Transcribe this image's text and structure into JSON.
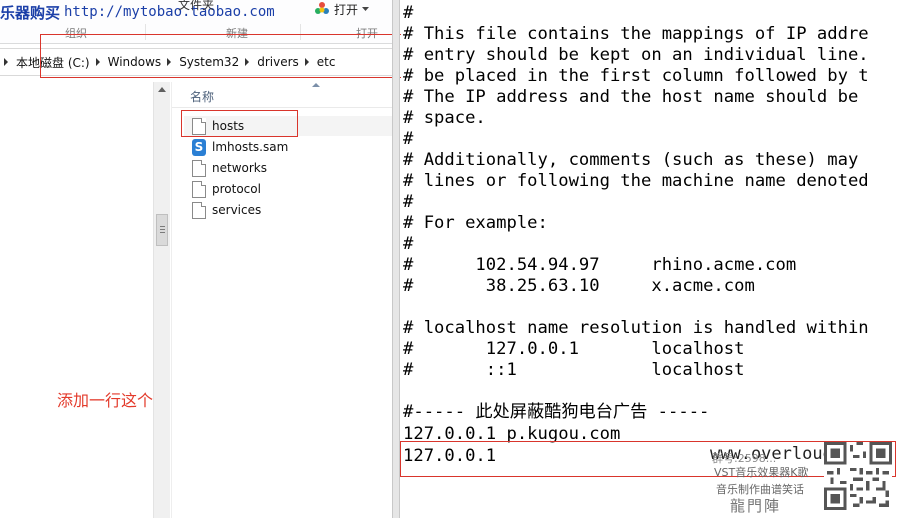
{
  "explorer": {
    "ribbon": {
      "ad_text": "乐器购买",
      "ad_url": "http://mytobao.taobao.com",
      "file_props": "文件夹",
      "open_label": "打开",
      "group_organize": "组织",
      "group_new": "新建",
      "group_open": "打开"
    },
    "breadcrumb": [
      "本地磁盘 (C:)",
      "Windows",
      "System32",
      "drivers",
      "etc"
    ],
    "column_header": "名称",
    "files": [
      {
        "name": "hosts",
        "icon": "document-icon"
      },
      {
        "name": "lmhosts.sam",
        "icon": "sam-file-icon"
      },
      {
        "name": "networks",
        "icon": "document-icon"
      },
      {
        "name": "protocol",
        "icon": "document-icon"
      },
      {
        "name": "services",
        "icon": "document-icon"
      }
    ],
    "annotation": "添加一行这个"
  },
  "editor": {
    "lines": [
      "#",
      "# This file contains the mappings of IP addre",
      "# entry should be kept on an individual line.",
      "# be placed in the first column followed by t",
      "# The IP address and the host name should be ",
      "# space.",
      "#",
      "# Additionally, comments (such as these) may ",
      "# lines or following the machine name denoted",
      "#",
      "# For example:",
      "#",
      "#      102.54.94.97     rhino.acme.com",
      "#       38.25.63.10     x.acme.com",
      "",
      "# localhost name resolution is handled within",
      "#\t127.0.0.1       localhost",
      "#\t::1             localhost",
      "",
      "#----- 此处屏蔽酷狗电台广告 -----",
      "127.0.0.1 p.kugou.com",
      "127.0.0.1"
    ]
  },
  "watermark": {
    "site": "www.overloud.com",
    "line1": "群号:2598...",
    "line2": "VST音乐效果器K歌",
    "line3": "音乐制作曲谱笑话",
    "logo": "龍門陣"
  }
}
